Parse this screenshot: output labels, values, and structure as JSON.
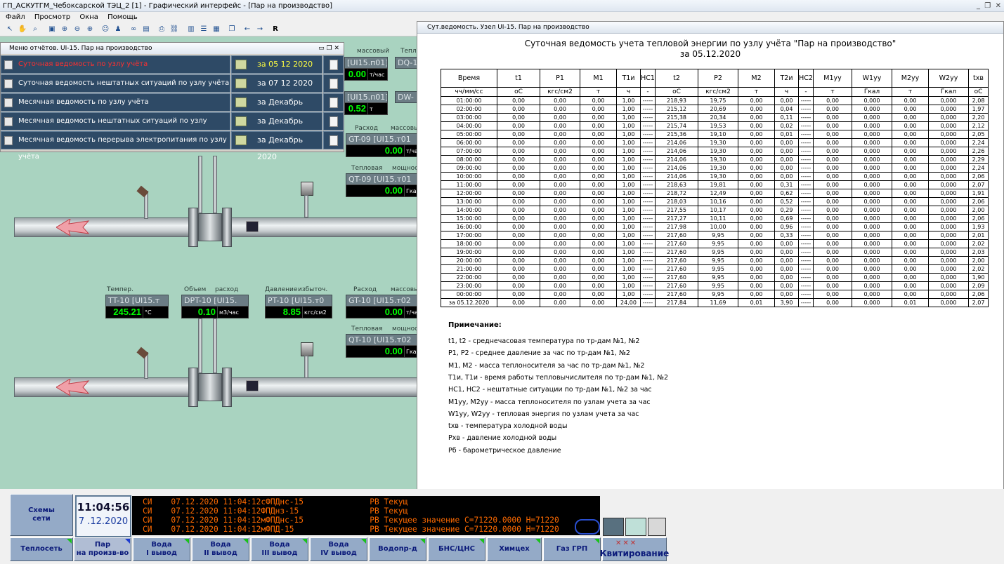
{
  "app_title": "ГП_АСКУТГМ_Чебоксарской ТЭЦ_2 [1] - Графический интерфейс - [Пар на производство]",
  "menu": [
    "Файл",
    "Просмотр",
    "Окна",
    "Помощь"
  ],
  "toolbar": {
    "r_label": "R"
  },
  "scada": {
    "top_labels": {
      "flow1": "массовый",
      "heat1": "Тепло"
    },
    "top_tags": [
      {
        "tag": "[UI15.п01]",
        "value": "0.00",
        "unit": "т/час"
      },
      {
        "tag": "DQ-1",
        "value": "",
        "unit": ""
      },
      {
        "tag": "[UI15.п01]",
        "value": "0.52",
        "unit": "т"
      },
      {
        "tag": "DW-",
        "value": "",
        "unit": ""
      }
    ],
    "gt09": {
      "lbl1": "Расход",
      "lbl2": "массовы",
      "tag": "GT-09  [UI15.т01",
      "value": "0.00",
      "unit": "т/ча"
    },
    "qt09": {
      "lbl1": "Тепловая",
      "lbl2": "мощност",
      "tag": "QT-09  [UI15.т01",
      "value": "0.00",
      "unit": "Гкал"
    },
    "tt10": {
      "lbl": "Темпер.",
      "tag": "TT-10  [UI15.т",
      "value": "245.21",
      "unit": "°C"
    },
    "dpt10": {
      "lbl1": "Объем",
      "lbl2": "расход",
      "tag": "DPT-10  [UI15.",
      "value": "0.10",
      "unit": "м3/час"
    },
    "pt10": {
      "lbl1": "Давление",
      "lbl2": "избыточ.",
      "tag": "PT-10  [UI15.т0",
      "value": "8.85",
      "unit": "кгс/см2"
    },
    "gt10": {
      "lbl1": "Расход",
      "lbl2": "массовы",
      "tag": "GT-10  [UI15.т02",
      "value": "0.00",
      "unit": "т/ча"
    },
    "qt10": {
      "lbl1": "Тепловая",
      "lbl2": "мощност",
      "tag": "QT-10  [UI15.т02",
      "value": "0.00",
      "unit": "Гкал"
    }
  },
  "report_menu": {
    "title": "Меню отчётов. UI-15. Пар на производство",
    "items": [
      {
        "name": "Суточная ведомость по узлу учёта",
        "date": "за 05 12 2020",
        "active": true
      },
      {
        "name": "Суточная ведомость нештатных ситуаций по узлу учёта",
        "date": "за 07 12 2020",
        "active": false
      },
      {
        "name": "Месячная ведомость по узлу учёта",
        "date": "за Декабрь 2020",
        "active": false
      },
      {
        "name": "Месячная ведомость нештатных ситуаций по узлу учёта",
        "date": "за Декабрь 2020",
        "active": false
      },
      {
        "name": "Месячная ведомость перерыва электропитания по узлу учёта",
        "date": "за Декабрь 2020",
        "active": false
      }
    ]
  },
  "report": {
    "window_title": "Сут.ведомость. Узел UI-15. Пар на производство",
    "heading": "Суточная ведомость учета тепловой энергии по узлу учёта \"Пар на производство\"",
    "date_line": "за 05.12.2020",
    "columns": [
      "Время",
      "t1",
      "P1",
      "M1",
      "T1и",
      "НС1",
      "t2",
      "P2",
      "M2",
      "T2и",
      "НС2",
      "M1уу",
      "W1уу",
      "M2уу",
      "W2уу",
      "txв"
    ],
    "units": [
      "чч/мм/сс",
      "оС",
      "кгс/см2",
      "т",
      "ч",
      "-",
      "оС",
      "кгс/см2",
      "т",
      "ч",
      "-",
      "т",
      "Гкал",
      "т",
      "Гкал",
      "оС"
    ],
    "rows": [
      [
        "01:00:00",
        "0,00",
        "0,00",
        "0,00",
        "1,00",
        "-----",
        "218,93",
        "19,75",
        "0,00",
        "0,00",
        "-----",
        "0,00",
        "0,000",
        "0,00",
        "0,000",
        "2,08"
      ],
      [
        "02:00:00",
        "0,00",
        "0,00",
        "0,00",
        "1,00",
        "-----",
        "215,12",
        "20,69",
        "0,00",
        "0,04",
        "-----",
        "0,00",
        "0,000",
        "0,00",
        "0,000",
        "1,97"
      ],
      [
        "03:00:00",
        "0,00",
        "0,00",
        "0,00",
        "1,00",
        "-----",
        "215,38",
        "20,34",
        "0,00",
        "0,11",
        "-----",
        "0,00",
        "0,000",
        "0,00",
        "0,000",
        "2,20"
      ],
      [
        "04:00:00",
        "0,00",
        "0,00",
        "0,00",
        "1,00",
        "-----",
        "215,74",
        "19,53",
        "0,00",
        "0,02",
        "-----",
        "0,00",
        "0,000",
        "0,00",
        "0,000",
        "2,12"
      ],
      [
        "05:00:00",
        "0,00",
        "0,00",
        "0,00",
        "1,00",
        "-----",
        "215,36",
        "19,10",
        "0,00",
        "0,01",
        "-----",
        "0,00",
        "0,000",
        "0,00",
        "0,000",
        "2,05"
      ],
      [
        "06:00:00",
        "0,00",
        "0,00",
        "0,00",
        "1,00",
        "-----",
        "214,06",
        "19,30",
        "0,00",
        "0,00",
        "-----",
        "0,00",
        "0,000",
        "0,00",
        "0,000",
        "2,24"
      ],
      [
        "07:00:00",
        "0,00",
        "0,00",
        "0,00",
        "1,00",
        "-----",
        "214,06",
        "19,30",
        "0,00",
        "0,00",
        "-----",
        "0,00",
        "0,000",
        "0,00",
        "0,000",
        "2,26"
      ],
      [
        "08:00:00",
        "0,00",
        "0,00",
        "0,00",
        "1,00",
        "-----",
        "214,06",
        "19,30",
        "0,00",
        "0,00",
        "-----",
        "0,00",
        "0,000",
        "0,00",
        "0,000",
        "2,29"
      ],
      [
        "09:00:00",
        "0,00",
        "0,00",
        "0,00",
        "1,00",
        "-----",
        "214,06",
        "19,30",
        "0,00",
        "0,00",
        "-----",
        "0,00",
        "0,000",
        "0,00",
        "0,000",
        "2,24"
      ],
      [
        "10:00:00",
        "0,00",
        "0,00",
        "0,00",
        "1,00",
        "-----",
        "214,06",
        "19,30",
        "0,00",
        "0,00",
        "-----",
        "0,00",
        "0,000",
        "0,00",
        "0,000",
        "2,06"
      ],
      [
        "11:00:00",
        "0,00",
        "0,00",
        "0,00",
        "1,00",
        "-----",
        "218,63",
        "19,81",
        "0,00",
        "0,31",
        "-----",
        "0,00",
        "0,000",
        "0,00",
        "0,000",
        "2,07"
      ],
      [
        "12:00:00",
        "0,00",
        "0,00",
        "0,00",
        "1,00",
        "-----",
        "218,72",
        "12,49",
        "0,00",
        "0,62",
        "-----",
        "0,00",
        "0,000",
        "0,00",
        "0,000",
        "1,91"
      ],
      [
        "13:00:00",
        "0,00",
        "0,00",
        "0,00",
        "1,00",
        "-----",
        "218,03",
        "10,16",
        "0,00",
        "0,52",
        "-----",
        "0,00",
        "0,000",
        "0,00",
        "0,000",
        "2,06"
      ],
      [
        "14:00:00",
        "0,00",
        "0,00",
        "0,00",
        "1,00",
        "-----",
        "217,55",
        "10,17",
        "0,00",
        "0,29",
        "-----",
        "0,00",
        "0,000",
        "0,00",
        "0,000",
        "2,00"
      ],
      [
        "15:00:00",
        "0,00",
        "0,00",
        "0,00",
        "1,00",
        "-----",
        "217,27",
        "10,11",
        "0,00",
        "0,69",
        "-----",
        "0,00",
        "0,000",
        "0,00",
        "0,000",
        "2,06"
      ],
      [
        "16:00:00",
        "0,00",
        "0,00",
        "0,00",
        "1,00",
        "-----",
        "217,98",
        "10,00",
        "0,00",
        "0,96",
        "-----",
        "0,00",
        "0,000",
        "0,00",
        "0,000",
        "1,93"
      ],
      [
        "17:00:00",
        "0,00",
        "0,00",
        "0,00",
        "1,00",
        "-----",
        "217,60",
        "9,95",
        "0,00",
        "0,33",
        "-----",
        "0,00",
        "0,000",
        "0,00",
        "0,000",
        "2,01"
      ],
      [
        "18:00:00",
        "0,00",
        "0,00",
        "0,00",
        "1,00",
        "-----",
        "217,60",
        "9,95",
        "0,00",
        "0,00",
        "-----",
        "0,00",
        "0,000",
        "0,00",
        "0,000",
        "2,02"
      ],
      [
        "19:00:00",
        "0,00",
        "0,00",
        "0,00",
        "1,00",
        "-----",
        "217,60",
        "9,95",
        "0,00",
        "0,00",
        "-----",
        "0,00",
        "0,000",
        "0,00",
        "0,000",
        "2,03"
      ],
      [
        "20:00:00",
        "0,00",
        "0,00",
        "0,00",
        "1,00",
        "-----",
        "217,60",
        "9,95",
        "0,00",
        "0,00",
        "-----",
        "0,00",
        "0,000",
        "0,00",
        "0,000",
        "2,00"
      ],
      [
        "21:00:00",
        "0,00",
        "0,00",
        "0,00",
        "1,00",
        "-----",
        "217,60",
        "9,95",
        "0,00",
        "0,00",
        "-----",
        "0,00",
        "0,000",
        "0,00",
        "0,000",
        "2,02"
      ],
      [
        "22:00:00",
        "0,00",
        "0,00",
        "0,00",
        "1,00",
        "-----",
        "217,60",
        "9,95",
        "0,00",
        "0,00",
        "-----",
        "0,00",
        "0,000",
        "0,00",
        "0,000",
        "1,90"
      ],
      [
        "23:00:00",
        "0,00",
        "0,00",
        "0,00",
        "1,00",
        "-----",
        "217,60",
        "9,95",
        "0,00",
        "0,00",
        "-----",
        "0,00",
        "0,000",
        "0,00",
        "0,000",
        "2,09"
      ],
      [
        "00:00:00",
        "0,00",
        "0,00",
        "0,00",
        "1,00",
        "-----",
        "217,60",
        "9,95",
        "0,00",
        "0,00",
        "-----",
        "0,00",
        "0,000",
        "0,00",
        "0,000",
        "2,06"
      ]
    ],
    "total": [
      "за 05.12.2020",
      "0,00",
      "0,00",
      "0,00",
      "24,00",
      "-----",
      "217,84",
      "11,69",
      "0,01",
      "3,90",
      "-----",
      "0,00",
      "0,000",
      "0,01",
      "0,000",
      "2,07"
    ],
    "notes_title": "Примечание:",
    "notes": [
      "t1, t2 - среднечасовая температура по тр-дам №1, №2",
      "P1, P2 - среднее давление за час по тр-дам №1, №2",
      "M1, M2 - масса теплоносителя за час по тр-дам №1, №2",
      "T1и, T1и - время работы тепловычислителя по тр-дам №1, №2",
      "НС1, НС2 - нештатные ситуации по тр-дам №1, №2 за час",
      "M1уу, M2уу - масса теплоносителя по узлам учета за час",
      "W1уу, W2уу - тепловая энергия по узлам учета за час",
      "txв - температура холодной воды",
      "Pxв - давление холодной воды",
      "Pб - барометрическое давление"
    ]
  },
  "bottom": {
    "schemes": "Схемы\nсети",
    "time": "11:04:56",
    "date": "7 .12.2020",
    "events": [
      "СИ    07.12.2020 11:04:12сФПДнс-15              РВ Текущ",
      "СИ    07.12.2020 11:04:12ФПДнз-15               РВ Текущ",
      "СИ    07.12.2020 11:04:12мФПДнс-15              РВ Текущее значение С=71220.0000 Н=71220",
      "СИ    07.12.2020 11:04:12мФПД-15                РВ Текущее значение С=71220.0000 Н=71220"
    ],
    "nav": [
      "Теплосеть",
      "Пар\nна произв-во",
      "Вода\nI вывод",
      "Вода\nII вывод",
      "Вода\nIII вывод",
      "Вода\nIV вывод",
      "Водопр-д",
      "БНС/ЦНС",
      "Химцех",
      "Газ ГРП",
      "Квитирование"
    ]
  }
}
